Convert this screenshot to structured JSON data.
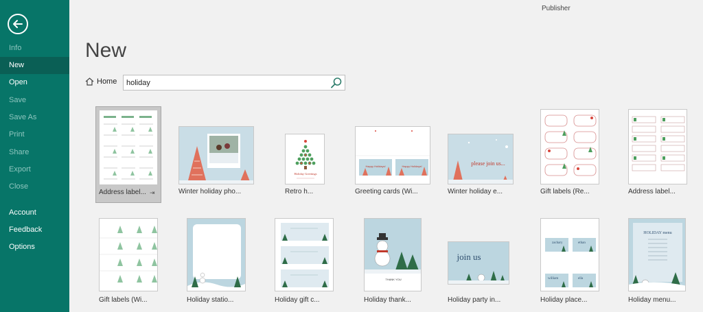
{
  "app": {
    "name": "Publisher"
  },
  "page": {
    "title": "New"
  },
  "nav": {
    "items": [
      {
        "label": "Info",
        "state": "dim"
      },
      {
        "label": "New",
        "state": "active"
      },
      {
        "label": "Open",
        "state": "strong"
      },
      {
        "label": "Save",
        "state": "dim"
      },
      {
        "label": "Save As",
        "state": "dim"
      },
      {
        "label": "Print",
        "state": "dim"
      },
      {
        "label": "Share",
        "state": "dim"
      },
      {
        "label": "Export",
        "state": "dim"
      },
      {
        "label": "Close",
        "state": "dim"
      },
      {
        "label": "Account",
        "state": "strong"
      },
      {
        "label": "Feedback",
        "state": "strong"
      },
      {
        "label": "Options",
        "state": "strong"
      }
    ]
  },
  "breadcrumb": {
    "home": "Home"
  },
  "search": {
    "value": "holiday"
  },
  "thumb_texts": {
    "holiday_greetings": "Holiday Greetings",
    "happy_holidays": "Happy Holidays!",
    "please_join_us": "please join us...",
    "join_us": "join us",
    "holiday_menu": "HOLIDAY menu",
    "thank_you": "THANK YOU",
    "place_names": [
      "zachary",
      "ethan",
      "william",
      "ella"
    ]
  },
  "templates": [
    {
      "label": "Address label...",
      "selected": true,
      "pin": "⇥"
    },
    {
      "label": "Winter holiday pho..."
    },
    {
      "label": "Retro h..."
    },
    {
      "label": "Greeting cards (Wi..."
    },
    {
      "label": "Winter holiday e..."
    },
    {
      "label": "Gift labels (Re..."
    },
    {
      "label": "Address label..."
    },
    {
      "label": "Gift labels (Wi..."
    },
    {
      "label": "Holiday statio..."
    },
    {
      "label": "Holiday gift c..."
    },
    {
      "label": "Holiday thank..."
    },
    {
      "label": "Holiday party in..."
    },
    {
      "label": "Holiday place..."
    },
    {
      "label": "Holiday menu..."
    }
  ],
  "colors": {
    "sidebar": "#077568",
    "sidebar_active": "#0a5f55",
    "accent_red": "#d8463c",
    "accent_green": "#3f8f5a"
  }
}
